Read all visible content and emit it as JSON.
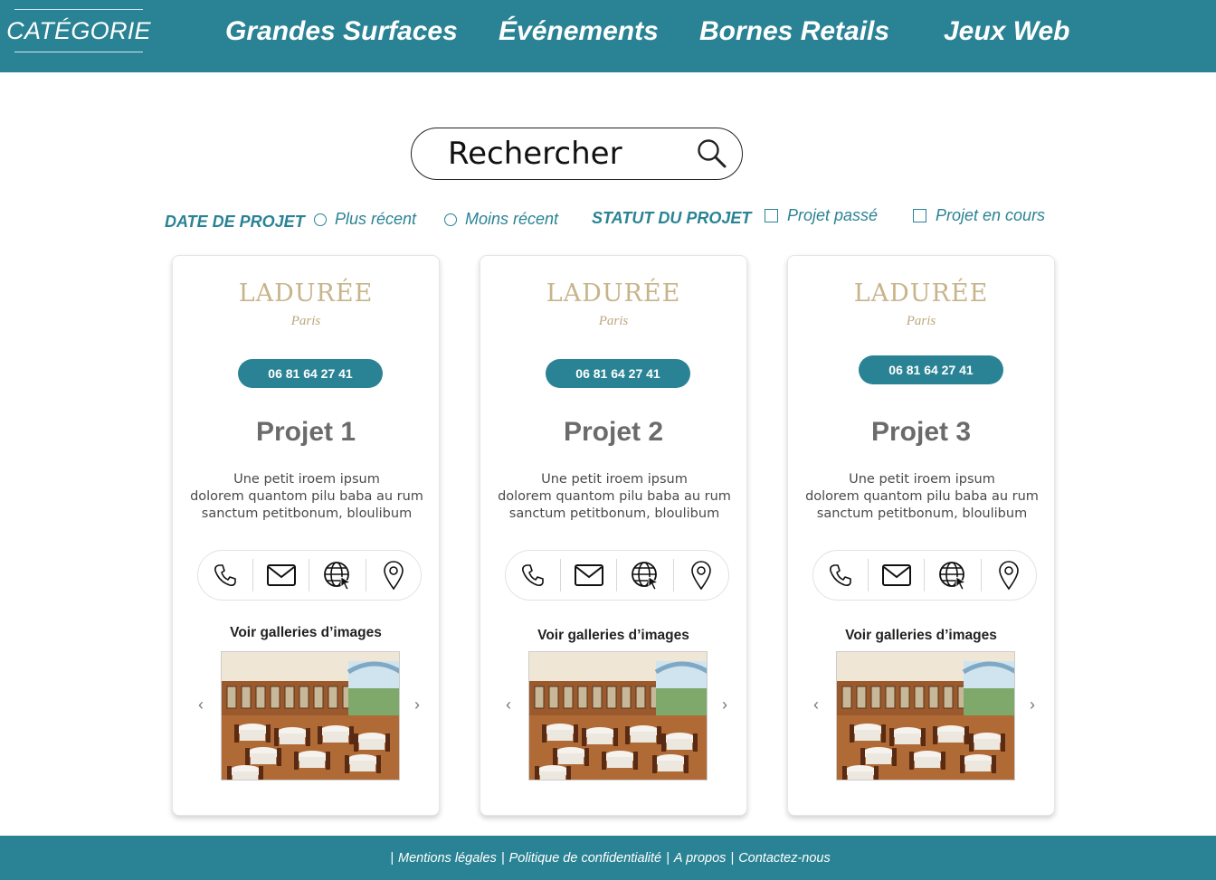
{
  "header": {
    "category_label": "CATÉGORIE",
    "nav": [
      "Grandes Surfaces",
      "Événements",
      "Bornes Retails",
      "Jeux Web"
    ]
  },
  "search": {
    "placeholder": "Rechercher",
    "icon": "search-icon"
  },
  "filters": {
    "date_heading": "DATE DE PROJET",
    "date_options": [
      "Plus récent",
      "Moins récent"
    ],
    "status_heading": "STATUT DU PROJET",
    "status_options": [
      "Projet passé",
      "Projet en cours"
    ]
  },
  "cards": [
    {
      "logo": "LADURÉE",
      "logo_sub": "Paris",
      "phone": "06 81 64 27 41",
      "title": "Projet 1",
      "desc": [
        "Une petit iroem ipsum",
        "dolorem quantom pilu baba au rum",
        "sanctum petitbonum,  bloulibum"
      ],
      "gallery_label": "Voir galleries d’images"
    },
    {
      "logo": "LADURÉE",
      "logo_sub": "Paris",
      "phone": "06 81 64 27 41",
      "title": "Projet 2",
      "desc": [
        "Une petit iroem ipsum",
        "dolorem quantom pilu baba au rum",
        "sanctum petitbonum,  bloulibum"
      ],
      "gallery_label": "Voir galleries d’images"
    },
    {
      "logo": "LADURÉE",
      "logo_sub": "Paris",
      "phone": "06 81 64 27 41",
      "title": "Projet 3",
      "desc": [
        "Une petit iroem ipsum",
        "dolorem quantom pilu baba au rum",
        "sanctum petitbonum,  bloulibum"
      ],
      "gallery_label": "Voir galleries d’images"
    }
  ],
  "contact_icons": [
    "phone-icon",
    "mail-icon",
    "globe-icon",
    "location-pin-icon"
  ],
  "footer": {
    "links": [
      "Mentions légales",
      "Politique de confidentialité",
      "A propos",
      "Contactez-nous"
    ],
    "separator": "|"
  },
  "colors": {
    "accent": "#2a8394",
    "logo_gold": "#c8b48a",
    "title_gray": "#6b6b6b"
  }
}
